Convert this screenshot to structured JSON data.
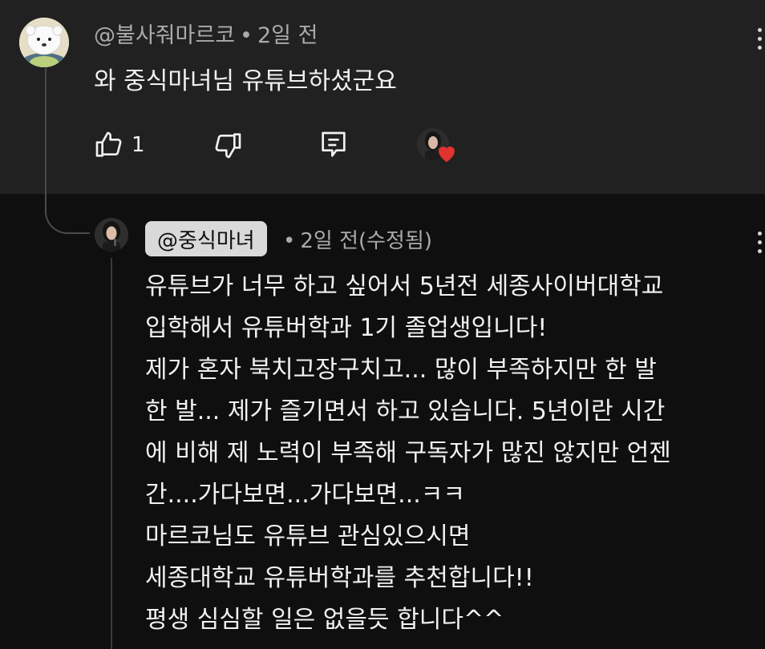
{
  "top_comment": {
    "handle": "@불사줘마르코",
    "separator": "•",
    "time": "2일 전",
    "text": "와 중식마녀님 유튜브하셨군요",
    "like_count": "1",
    "icons": {
      "like": "thumbs-up-icon",
      "dislike": "thumbs-down-icon",
      "reply": "reply-icon",
      "menu": "kebab-menu-icon",
      "creator_heart": "creator-heart-icon"
    }
  },
  "reply": {
    "handle": "@중식마녀",
    "separator": "•",
    "meta": "2일 전(수정됨)",
    "lines": [
      "유튜브가 너무 하고 싶어서 5년전 세종사이버대학교",
      "입학해서 유튜버학과 1기 졸업생입니다!",
      "제가 혼자 북치고장구치고... 많이 부족하지만 한 발",
      "한 발... 제가 즐기면서 하고 있습니다. 5년이란 시간",
      "에 비해 제 노력이 부족해 구독자가 많진 않지만 언젠",
      "간....가다보면...가다보면...ㅋㅋ",
      "마르코님도 유튜브 관심있으시면",
      "세종대학교 유튜버학과를 추천합니다!!",
      "평생 심심할 일은 없을듯 합니다^^"
    ]
  },
  "colors": {
    "top_comment_bg": "#212121",
    "reply_bg": "#0f0f0f",
    "primary_text": "#f1f1f1",
    "secondary_text": "#aaaaaa",
    "handle_pill_bg": "#d9d9d9",
    "heart": "#e0322f"
  }
}
